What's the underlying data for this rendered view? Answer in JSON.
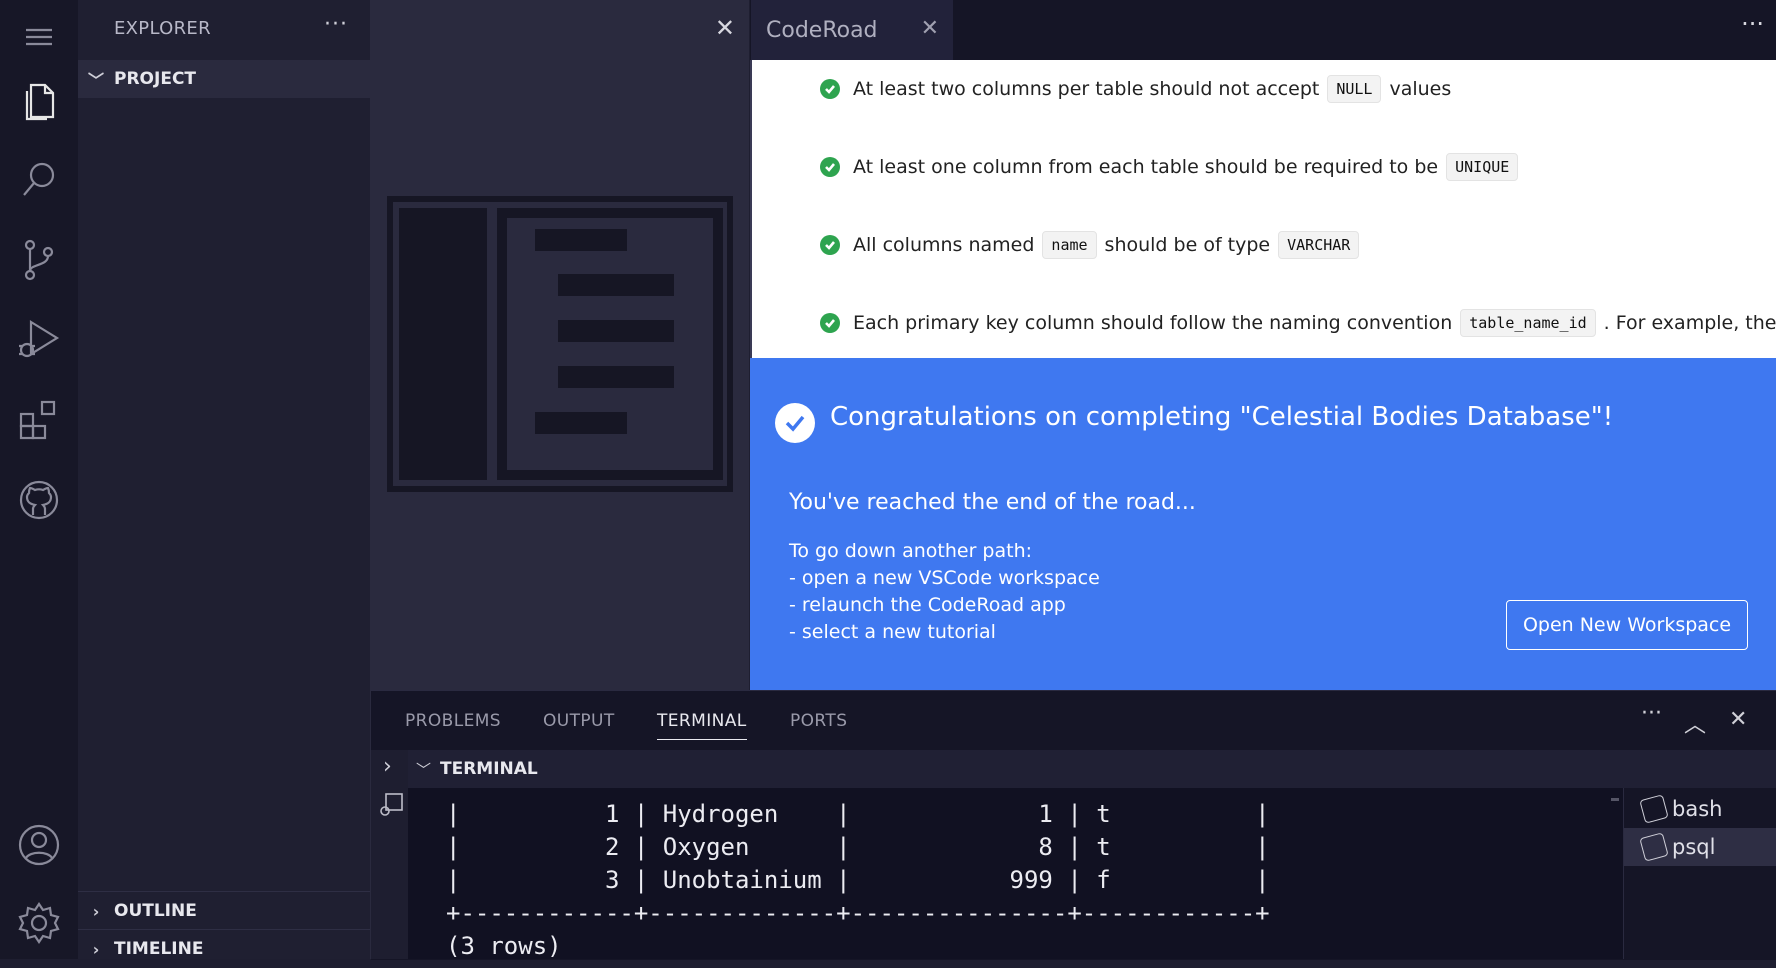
{
  "activity_bar": {
    "items": [
      {
        "name": "menu-icon"
      },
      {
        "name": "explorer-icon"
      },
      {
        "name": "search-icon"
      },
      {
        "name": "source-control-icon"
      },
      {
        "name": "run-debug-icon"
      },
      {
        "name": "extensions-icon"
      },
      {
        "name": "github-icon"
      },
      {
        "name": "accounts-icon"
      },
      {
        "name": "settings-gear-icon"
      }
    ]
  },
  "sidebar": {
    "title": "EXPLORER",
    "more": "···",
    "sections": {
      "project": "PROJECT",
      "outline": "OUTLINE",
      "timeline": "TIMELINE"
    }
  },
  "editor": {
    "left_close": "✕",
    "tab_label": "CodeRoad",
    "tab_close": "✕",
    "more": "···"
  },
  "steps": [
    {
      "text_before": "At least two columns per table should not accept",
      "code": "NULL",
      "text_after": "values"
    },
    {
      "text_before": "At least one column from each table should be required to be",
      "code": "UNIQUE",
      "text_after": ""
    },
    {
      "text_before": "All columns named",
      "code": "name",
      "text_after": "should be of type",
      "code2": "VARCHAR"
    },
    {
      "text_before": "Each primary key column should follow the naming convention",
      "code": "table_name_id",
      "text_after": ". For example, the"
    }
  ],
  "banner": {
    "title": "Congratulations on completing \"Celestial Bodies Database\"!",
    "subtitle": "You've reached the end of the road...",
    "path_lines": [
      "To go down another path:",
      "- open a new VSCode workspace",
      "- relaunch the CodeRoad app",
      "- select a new tutorial"
    ],
    "button": "Open New Workspace",
    "accent": "#3f78f0"
  },
  "panel": {
    "tabs": [
      "PROBLEMS",
      "OUTPUT",
      "TERMINAL",
      "PORTS"
    ],
    "active_tab": "TERMINAL",
    "more": "···",
    "maximize": "︿",
    "close": "✕"
  },
  "terminal": {
    "header": "TERMINAL",
    "lines": [
      "|          1 | Hydrogen    |             1 | t          |",
      "|          2 | Oxygen      |             8 | t          |",
      "|          3 | Unobtainium |           999 | f          |",
      "+------------+-------------+---------------+------------+",
      "(3 rows)"
    ],
    "instances": [
      {
        "label": "bash",
        "selected": false
      },
      {
        "label": "psql",
        "selected": true
      }
    ]
  }
}
